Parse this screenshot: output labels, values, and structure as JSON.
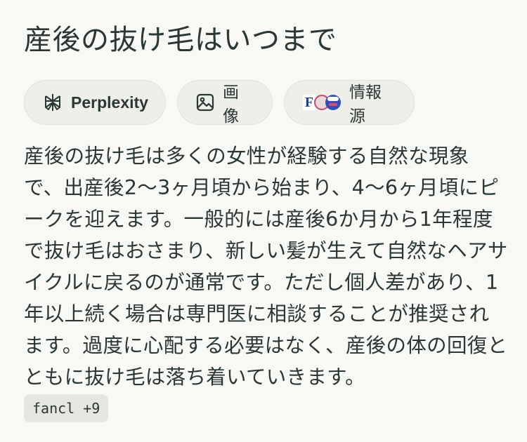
{
  "title": "産後の抜け毛はいつまで",
  "chips": {
    "perplexity": {
      "label": "Perplexity",
      "icon": "perplexity-logo-icon"
    },
    "images": {
      "label": "画像",
      "icon": "image-icon"
    },
    "sources": {
      "label": "情報源",
      "icon": "source-favicons-icon",
      "favicon_letter": "F"
    }
  },
  "answer": {
    "text": "産後の抜け毛は多くの女性が経験する自然な現象で、出産後2〜3ヶ月頃から始まり、4〜6ヶ月頃にピークを迎えます。一般的には産後6か月から1年程度で抜け毛はおさまり、新しい髪が生えて自然なヘアサイクルに戻るのが通常です。ただし個人差があり、1年以上続く場合は専門医に相談することが推奨されます。過度に心配する必要はなく、産後の体の回復とともに抜け毛は落ち着いていきます。"
  },
  "citation": {
    "label": "fancl +9"
  },
  "colors": {
    "background": "#f8f8f5",
    "chip_background": "#efefea",
    "text": "#2a3735",
    "citation_background": "#e6e6e1"
  }
}
